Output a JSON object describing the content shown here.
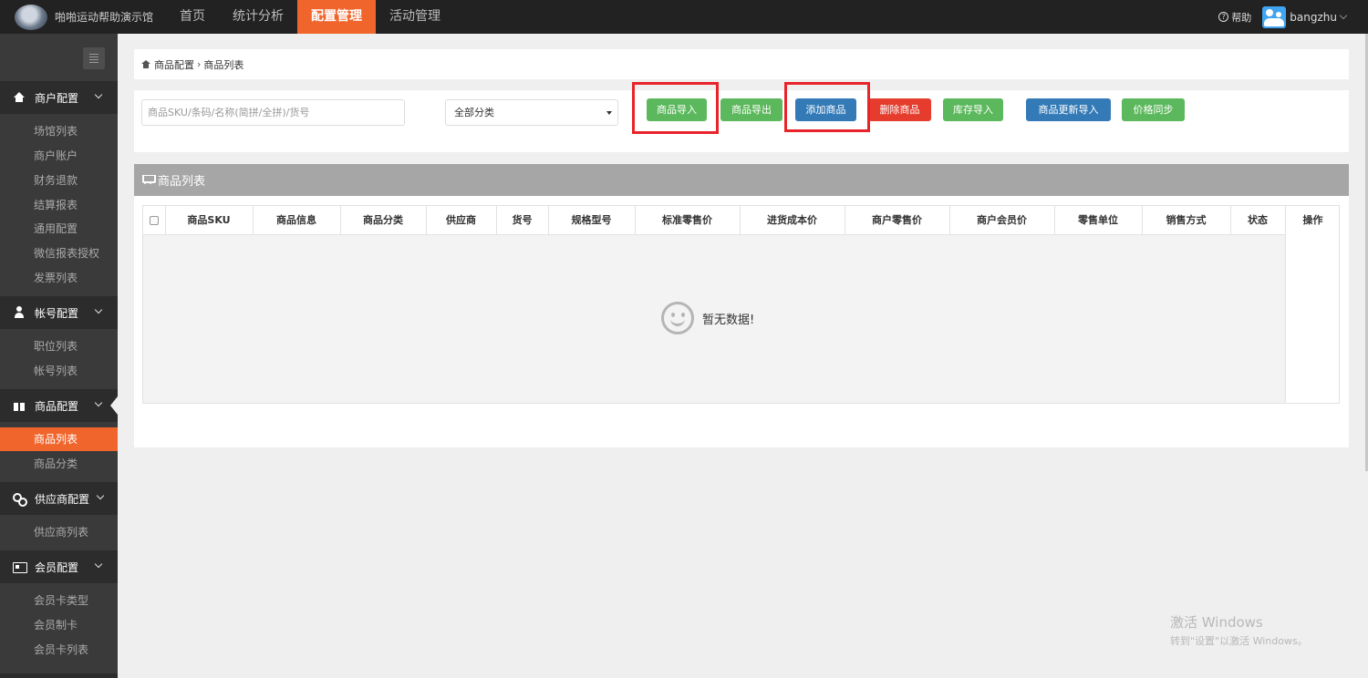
{
  "brand": {
    "name": "啪啪运动帮助演示馆"
  },
  "nav": [
    {
      "label": "首页"
    },
    {
      "label": "统计分析"
    },
    {
      "label": "配置管理"
    },
    {
      "label": "活动管理"
    }
  ],
  "topright": {
    "help": "帮助",
    "username": "bangzhu"
  },
  "sidebar": {
    "groups": [
      {
        "label": "商户配置",
        "icon": "home-icon",
        "items": [
          "场馆列表",
          "商户账户",
          "财务退款",
          "结算报表",
          "通用配置",
          "微信报表授权",
          "发票列表"
        ]
      },
      {
        "label": "帐号配置",
        "icon": "user-icon",
        "items": [
          "职位列表",
          "帐号列表"
        ]
      },
      {
        "label": "商品配置",
        "icon": "gift-icon",
        "items": [
          "商品列表",
          "商品分类"
        ],
        "active_item": "商品列表"
      },
      {
        "label": "供应商配置",
        "icon": "link-icon",
        "items": [
          "供应商列表"
        ]
      },
      {
        "label": "会员配置",
        "icon": "card-icon",
        "items": [
          "会员卡类型",
          "会员制卡",
          "会员卡列表"
        ]
      }
    ]
  },
  "breadcrumb": {
    "parent": "商品配置",
    "separator": "›",
    "current": "商品列表"
  },
  "filter": {
    "search_placeholder": "商品SKU/条码/名称(简拼/全拼)/货号",
    "category_selected": "全部分类",
    "buttons": [
      {
        "label": "商品导入",
        "color": "#5cb85c"
      },
      {
        "label": "商品导出",
        "color": "#5cb85c"
      },
      {
        "label": "添加商品",
        "color": "#337ab7"
      },
      {
        "label": "删除商品",
        "color": "#e53c2d"
      },
      {
        "label": "库存导入",
        "color": "#5cb85c"
      },
      {
        "label": "商品更新导入",
        "color": "#337ab7"
      },
      {
        "label": "价格同步",
        "color": "#5cb85c"
      }
    ]
  },
  "list": {
    "title": "商品列表",
    "columns": [
      "商品SKU",
      "商品信息",
      "商品分类",
      "供应商",
      "货号",
      "规格型号",
      "标准零售价",
      "进货成本价",
      "商户零售价",
      "商户会员价",
      "零售单位",
      "销售方式",
      "状态"
    ],
    "ops_column": "操作",
    "empty_text": "暂无数据!"
  },
  "watermark": {
    "line1": "激活 Windows",
    "line2": "转到\"设置\"以激活 Windows。"
  },
  "colors": {
    "accent": "#f0652c",
    "topbar": "#222222",
    "sidebar": "#3a3a3a",
    "highlight": "#e8232a"
  }
}
